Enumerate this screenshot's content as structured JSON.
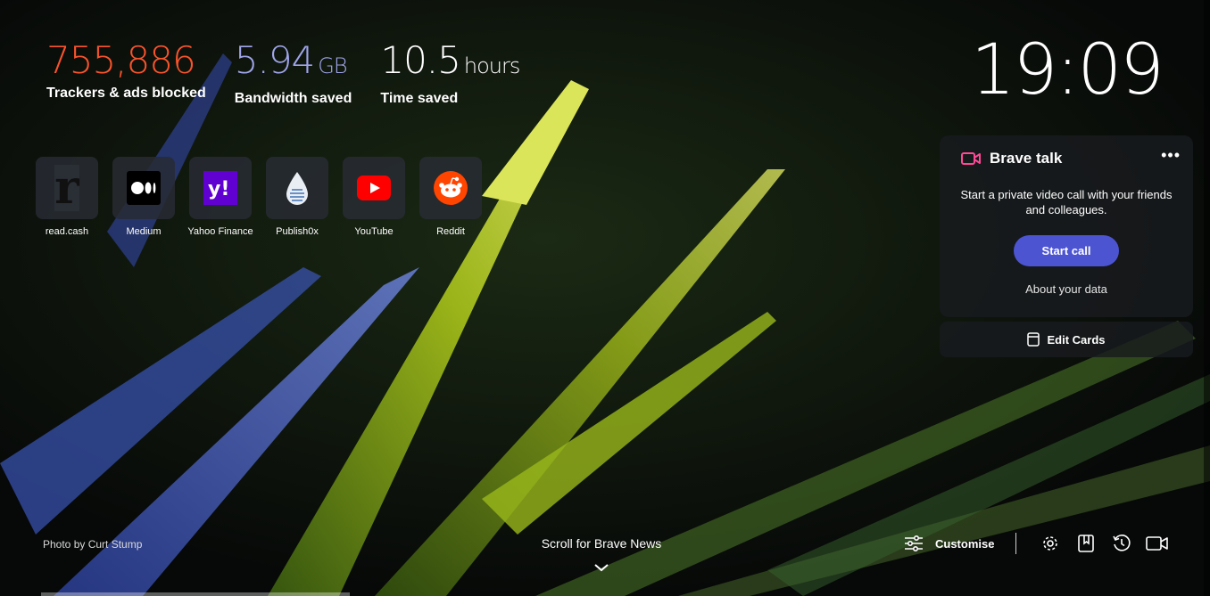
{
  "background": {
    "credit": "Photo by Curt Stump"
  },
  "stats": [
    {
      "value": "755,886",
      "unit": "",
      "label": "Trackers & ads blocked",
      "color": "#fb542b"
    },
    {
      "value": "5.94",
      "unit": "GB",
      "label": "Bandwidth saved",
      "color": "#a0a5eb"
    },
    {
      "value": "10.5",
      "unit": "hours",
      "label": "Time saved",
      "color": "#ffffff"
    }
  ],
  "clock": "19:09",
  "top_sites": [
    {
      "name": "read.cash",
      "icon": "read-cash-icon"
    },
    {
      "name": "Medium",
      "icon": "medium-icon"
    },
    {
      "name": "Yahoo Finance",
      "icon": "yahoo-icon"
    },
    {
      "name": "Publish0x",
      "icon": "publish0x-icon"
    },
    {
      "name": "YouTube",
      "icon": "youtube-icon"
    },
    {
      "name": "Reddit",
      "icon": "reddit-icon"
    }
  ],
  "brave_talk": {
    "title": "Brave talk",
    "more": "•••",
    "description": "Start a private video call with your friends and colleagues.",
    "start_button": "Start call",
    "about_link": "About your data",
    "accent": "#ff4996"
  },
  "edit_cards": "Edit Cards",
  "news_prompt": "Scroll for Brave News",
  "footer": {
    "customise": "Customise",
    "icons": [
      "settings-icon",
      "bookmarks-icon",
      "history-icon",
      "brave-talk-icon"
    ]
  },
  "colors": {
    "start_button": "#4c54d2",
    "card_bg": "#191b1e"
  }
}
